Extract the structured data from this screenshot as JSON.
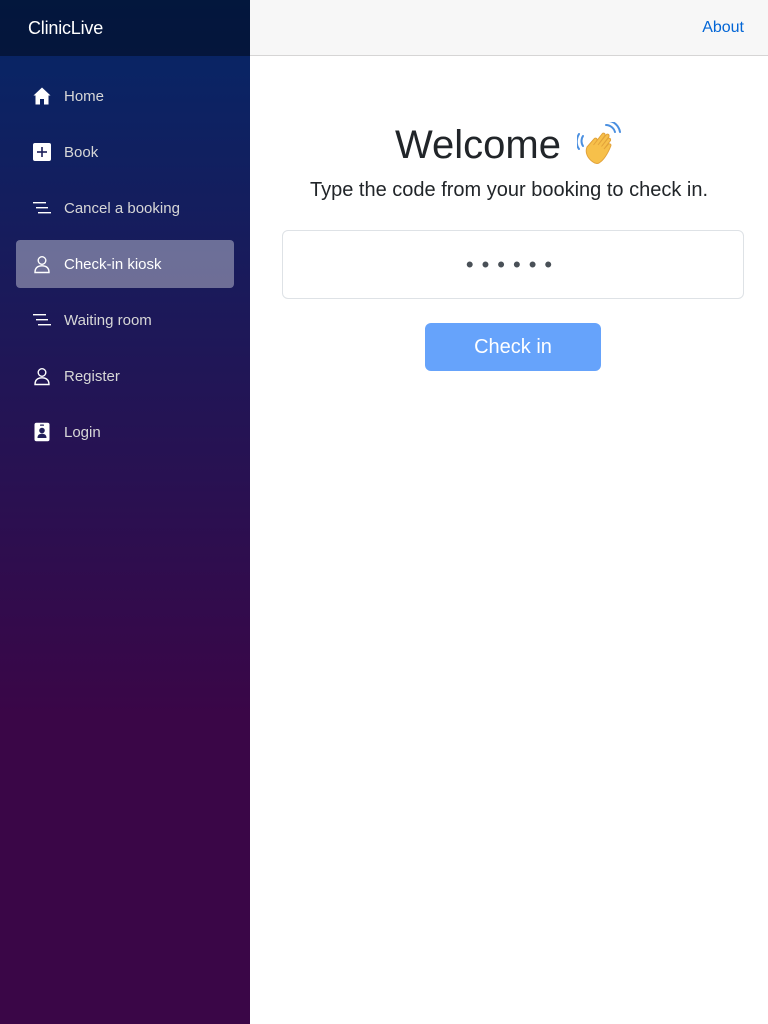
{
  "app": {
    "brand": "ClinicLive"
  },
  "sidebar": {
    "items": [
      {
        "label": "Home",
        "icon": "home-icon"
      },
      {
        "label": "Book",
        "icon": "plus-square-icon"
      },
      {
        "label": "Cancel a booking",
        "icon": "list-lines-icon"
      },
      {
        "label": "Check-in kiosk",
        "icon": "person-icon",
        "active": true
      },
      {
        "label": "Waiting room",
        "icon": "list-lines-icon"
      },
      {
        "label": "Register",
        "icon": "person-icon"
      },
      {
        "label": "Login",
        "icon": "badge-icon"
      }
    ]
  },
  "top_row": {
    "about_label": "About"
  },
  "main": {
    "title": "Welcome",
    "title_icon": "waving-hand-icon",
    "subtitle": "Type the code from your booking to check in.",
    "code_input": {
      "value": "••••••",
      "placeholder": ""
    },
    "checkin_label": "Check in"
  },
  "colors": {
    "sidebar_top": "#052767",
    "sidebar_bottom": "#3a0647",
    "link": "#0366d6",
    "button": "#66a3fb",
    "active_item_bg": "rgba(255,255,255,0.37)"
  }
}
